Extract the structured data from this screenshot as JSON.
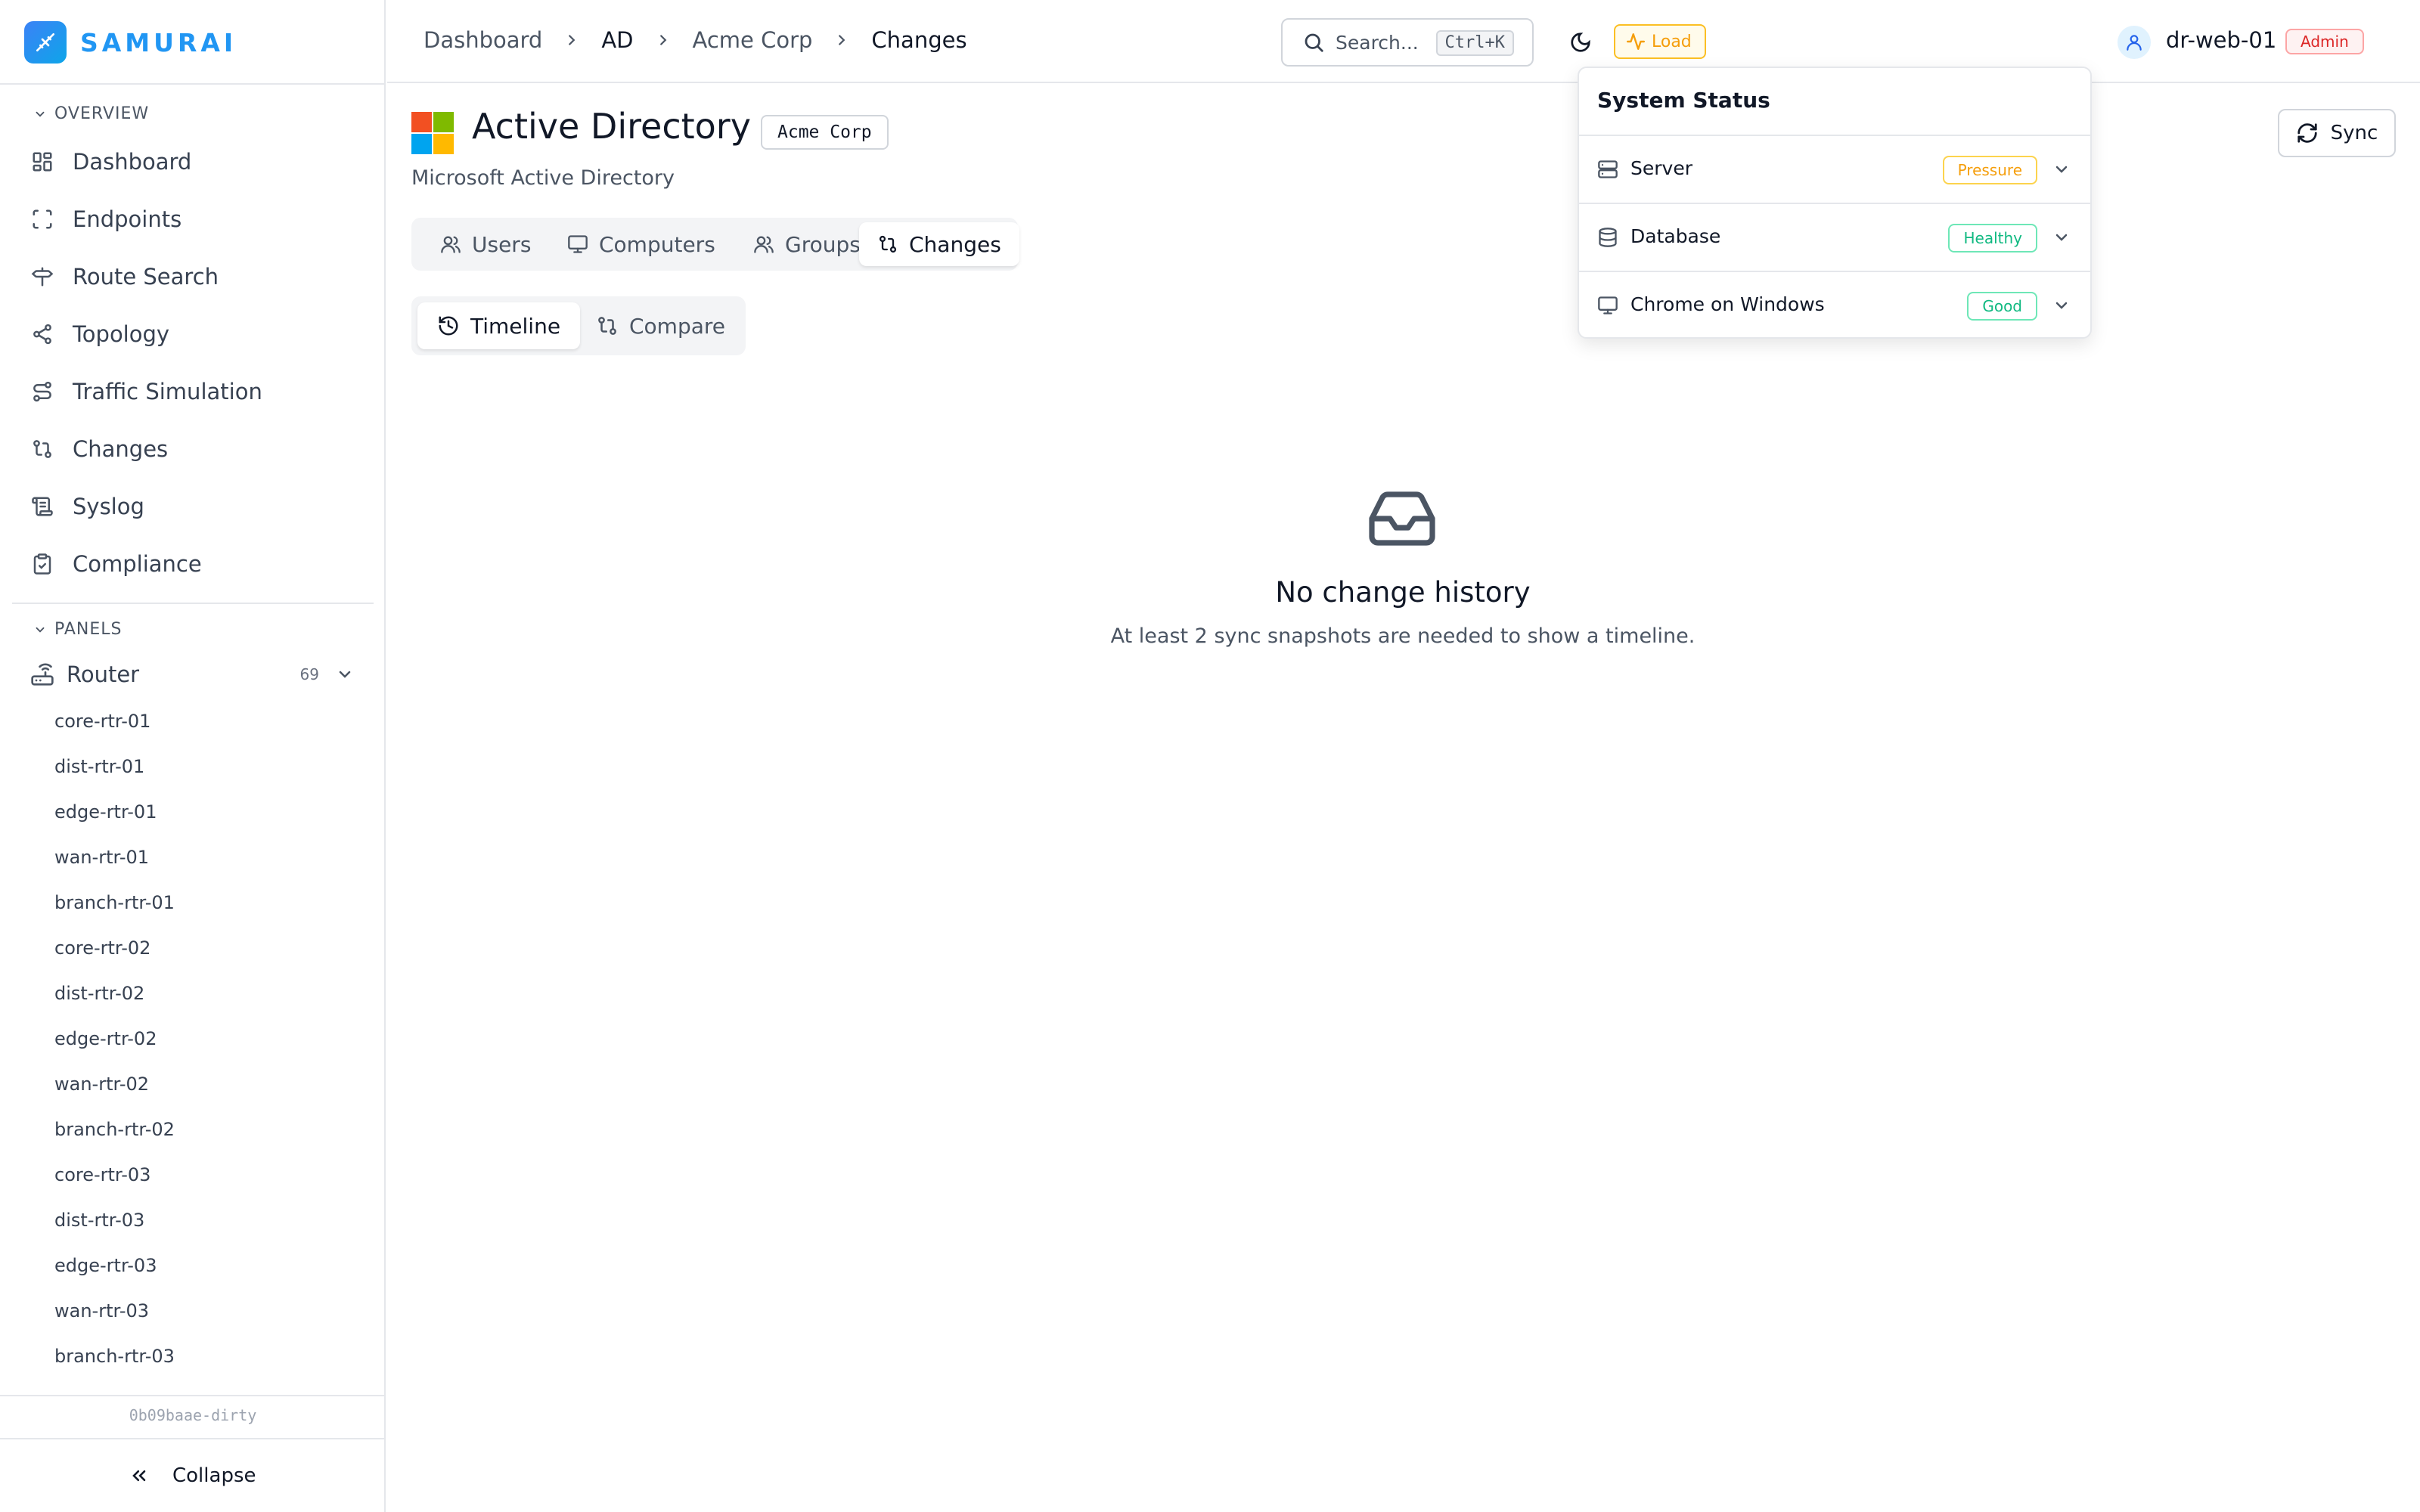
{
  "app": {
    "name": "SAMURAI",
    "version": "0b09baae-dirty"
  },
  "sidebar": {
    "overview_label": "OVERVIEW",
    "nav": [
      {
        "label": "Dashboard",
        "icon": "dashboard-icon"
      },
      {
        "label": "Endpoints",
        "icon": "endpoints-icon"
      },
      {
        "label": "Route Search",
        "icon": "route-search-icon"
      },
      {
        "label": "Topology",
        "icon": "topology-icon"
      },
      {
        "label": "Traffic Simulation",
        "icon": "traffic-simulation-icon"
      },
      {
        "label": "Changes",
        "icon": "changes-icon"
      },
      {
        "label": "Syslog",
        "icon": "syslog-icon"
      },
      {
        "label": "Compliance",
        "icon": "compliance-icon"
      }
    ],
    "panels_label": "PANELS",
    "router_group": {
      "label": "Router",
      "count": "69"
    },
    "devices": [
      "core-rtr-01",
      "dist-rtr-01",
      "edge-rtr-01",
      "wan-rtr-01",
      "branch-rtr-01",
      "core-rtr-02",
      "dist-rtr-02",
      "edge-rtr-02",
      "wan-rtr-02",
      "branch-rtr-02",
      "core-rtr-03",
      "dist-rtr-03",
      "edge-rtr-03",
      "wan-rtr-03",
      "branch-rtr-03"
    ],
    "collapse_label": "Collapse"
  },
  "header": {
    "breadcrumb": [
      "Dashboard",
      "AD",
      "Acme Corp",
      "Changes"
    ],
    "search_placeholder": "Search...",
    "search_shortcut": "Ctrl+K",
    "load_label": "Load",
    "user": "dr-web-01",
    "role": "Admin"
  },
  "page": {
    "title": "Active Directory",
    "org_badge": "Acme Corp",
    "subtitle": "Microsoft Active Directory",
    "sync_label": "Sync",
    "tabs": [
      {
        "label": "Users",
        "icon": "users-icon"
      },
      {
        "label": "Computers",
        "icon": "monitor-icon"
      },
      {
        "label": "Groups",
        "icon": "groups-icon"
      },
      {
        "label": "Changes",
        "icon": "changes-icon"
      }
    ],
    "active_tab": "Changes",
    "subtabs": [
      {
        "label": "Timeline",
        "icon": "history-icon"
      },
      {
        "label": "Compare",
        "icon": "compare-icon"
      }
    ],
    "active_subtab": "Timeline",
    "empty": {
      "title": "No change history",
      "description": "At least 2 sync snapshots are needed to show a timeline."
    }
  },
  "system_status": {
    "title": "System Status",
    "rows": [
      {
        "label": "Server",
        "status": "Pressure",
        "icon": "server-icon"
      },
      {
        "label": "Database",
        "status": "Healthy",
        "icon": "database-icon"
      },
      {
        "label": "Chrome on Windows",
        "status": "Good",
        "icon": "monitor-icon"
      }
    ]
  },
  "colors": {
    "brand": "#2196f3",
    "pressure": "#f59e0b",
    "healthy": "#10b981",
    "admin": "#dc2626"
  }
}
